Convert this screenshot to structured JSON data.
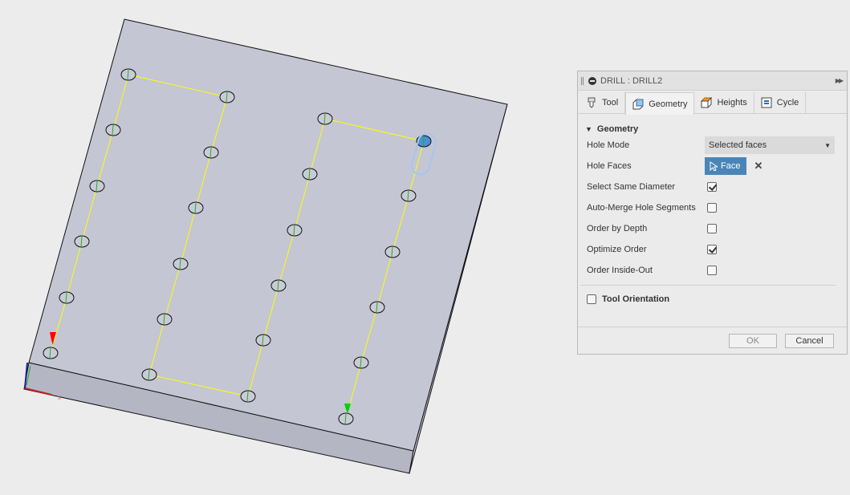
{
  "panel": {
    "title": "DRILL : DRILL2",
    "tabs": [
      {
        "label": "Tool",
        "icon": "drill-tool-icon"
      },
      {
        "label": "Geometry",
        "icon": "geometry-box-icon"
      },
      {
        "label": "Heights",
        "icon": "heights-box-icon"
      },
      {
        "label": "Cycle",
        "icon": "cycle-icon"
      }
    ],
    "active_tab": "Geometry",
    "section": "Geometry",
    "hole_mode": {
      "label": "Hole Mode",
      "value": "Selected faces"
    },
    "hole_faces": {
      "label": "Hole Faces",
      "value": "Face"
    },
    "checks": [
      {
        "label": "Select Same Diameter",
        "checked": true
      },
      {
        "label": "Auto-Merge Hole Segments",
        "checked": false
      },
      {
        "label": "Order by Depth",
        "checked": false
      },
      {
        "label": "Optimize Order",
        "checked": true
      },
      {
        "label": "Order Inside-Out",
        "checked": false
      }
    ],
    "tool_orientation": {
      "label": "Tool Orientation",
      "checked": false
    },
    "ok": "OK",
    "cancel": "Cancel"
  },
  "colors": {
    "path": "#ffff00",
    "selected_hole": "#4a8fd8",
    "start_marker": "#ff0000",
    "end_marker": "#00c000",
    "face": "#c4c6d4"
  }
}
